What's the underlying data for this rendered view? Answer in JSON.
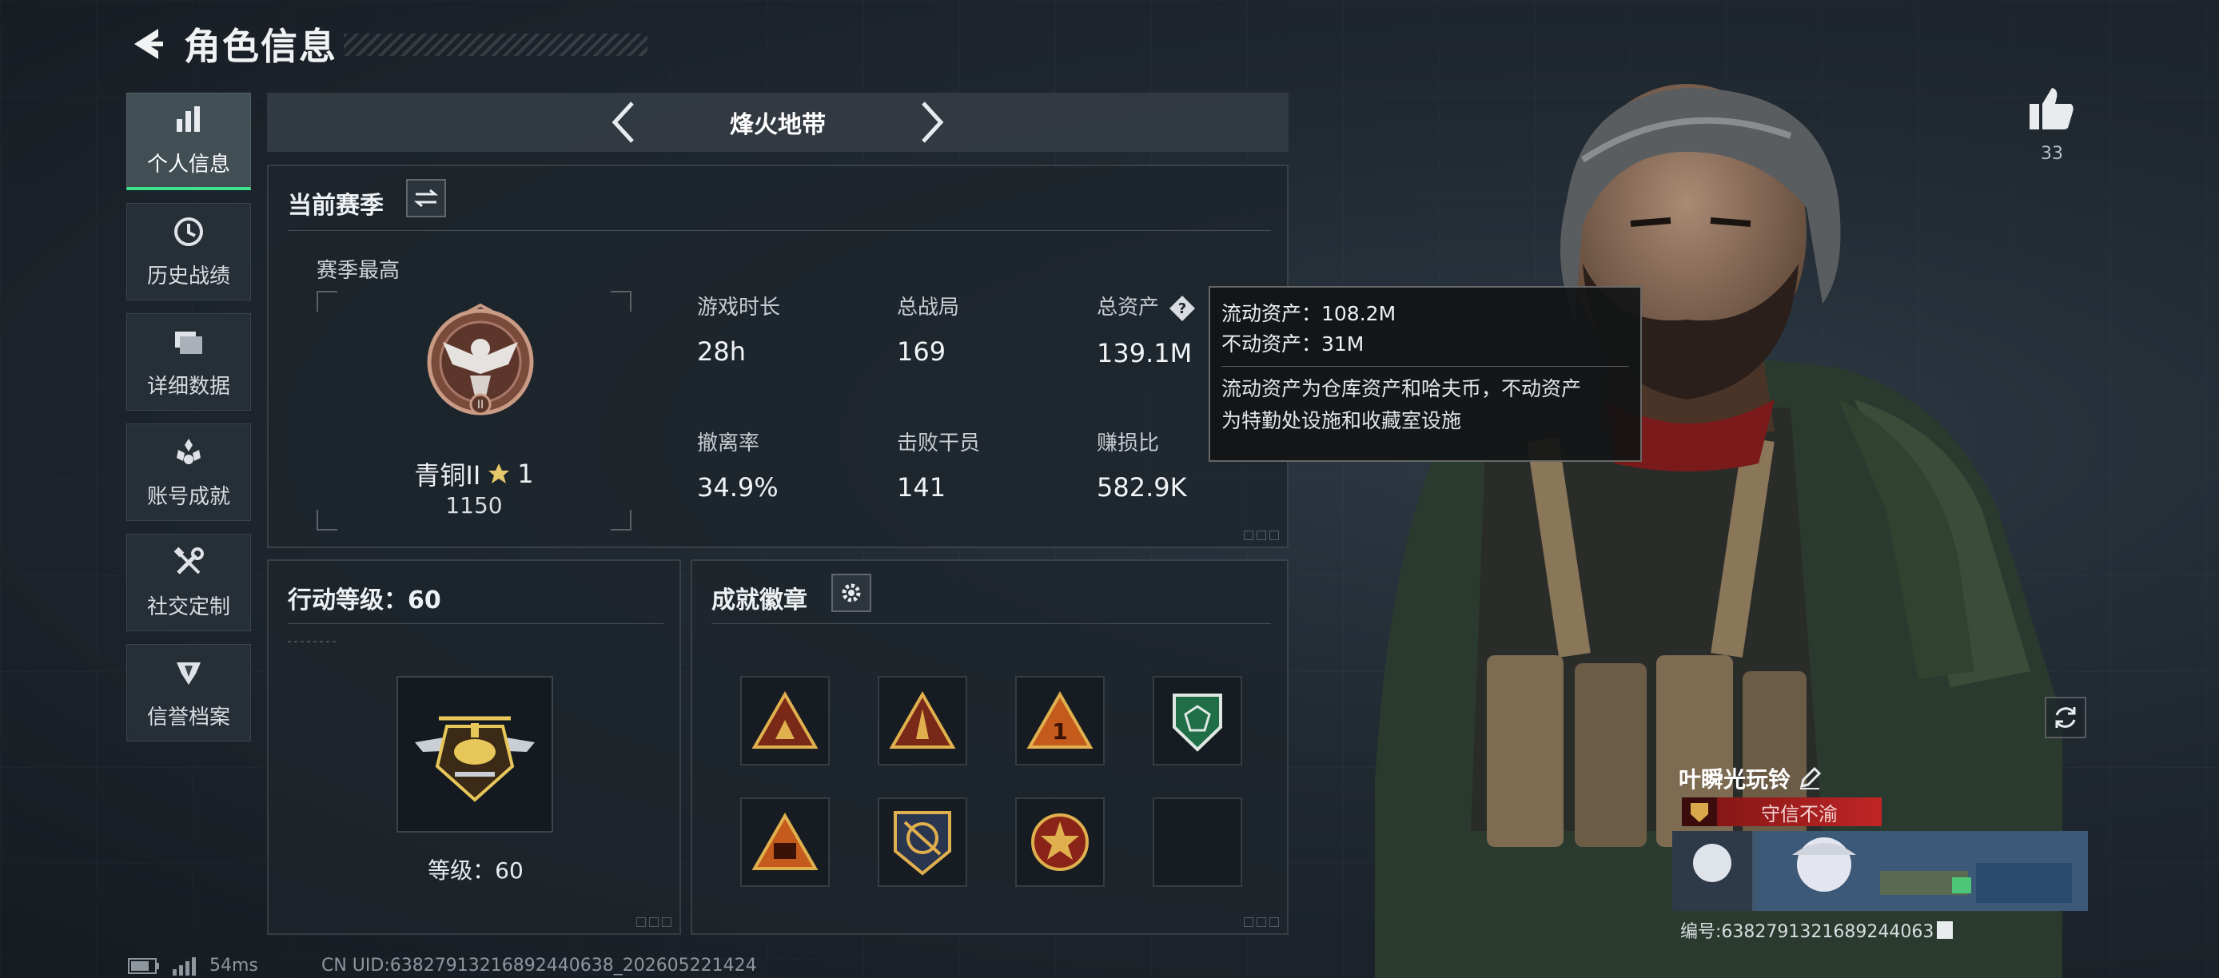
{
  "header": {
    "title": "角色信息"
  },
  "sidebar": {
    "items": [
      {
        "label": "个人信息",
        "icon": "bar-chart-icon",
        "active": true
      },
      {
        "label": "历史战绩",
        "icon": "history-icon"
      },
      {
        "label": "详细数据",
        "icon": "folder-icon"
      },
      {
        "label": "账号成就",
        "icon": "achievement-icon"
      },
      {
        "label": "社交定制",
        "icon": "tools-icon"
      },
      {
        "label": "信誉档案",
        "icon": "shield-icon"
      }
    ]
  },
  "mode": {
    "label": "烽火地带"
  },
  "season": {
    "title": "当前赛季",
    "best_label": "赛季最高",
    "rank_name": "青铜II",
    "rank_stars": "1",
    "rank_score": "1150",
    "stats": [
      {
        "key": "游戏时长",
        "value": "28h"
      },
      {
        "key": "总战局",
        "value": "169"
      },
      {
        "key": "总资产",
        "value": "139.1M"
      },
      {
        "key": "撤离率",
        "value": "34.9%"
      },
      {
        "key": "击败干员",
        "value": "141"
      },
      {
        "key": "赚损比",
        "value": "582.9K"
      }
    ]
  },
  "tooltip": {
    "line1": "流动资产：108.2M",
    "line2": "不动资产：31M",
    "desc1": "流动资产为仓库资产和哈夫币，不动资产",
    "desc2": "为特勤处设施和收藏室设施"
  },
  "level": {
    "title": "行动等级：60",
    "level_text": "等级：60"
  },
  "badges": {
    "title": "成就徽章"
  },
  "likes": {
    "count": "33"
  },
  "player": {
    "name": "叶瞬光玩铃",
    "honor": "守信不渝",
    "id_text": "编号:6382791321689244063"
  },
  "status": {
    "ping": "54ms",
    "uid": "CN UID:638279132168924406​38_202605221424"
  },
  "colors": {
    "accent": "#3ee38e",
    "honor": "#c02525",
    "panel": "#1e252c"
  }
}
